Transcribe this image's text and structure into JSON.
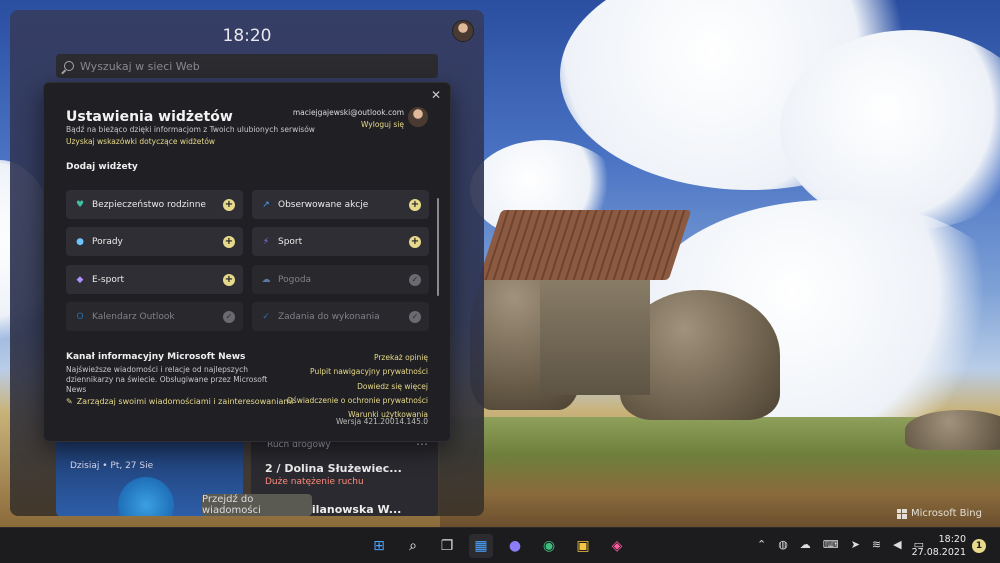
{
  "board": {
    "clock": "18:20",
    "search_placeholder": "Wyszukaj w sieci Web",
    "today": "Dzisiaj • Pt, 27 Sie",
    "traffic_label": "Ruch drogowy",
    "traffic_title": "2 / Dolina Służewiec...",
    "traffic_status": "Duże natężenie ruchu",
    "traffic_road": "Aleja Wilanowska W...",
    "toast": "Przejdź do wiadomości"
  },
  "dialog": {
    "close": "✕",
    "title": "Ustawienia widżetów",
    "subtitle": "Bądź na bieżąco dzięki informacjom z Twoich ulubionych serwisów",
    "tips_link": "Uzyskaj wskazówki dotyczące widżetów",
    "account_email": "maciejgajewski@outlook.com",
    "logout": "Wyloguj się",
    "add_widgets": "Dodaj widżety",
    "widgets": [
      {
        "label": "Bezpieczeństwo rodzinne",
        "icon": "heart-icon",
        "glyph": "♥",
        "color": "#3fbf9f",
        "state": "add"
      },
      {
        "label": "Obserwowane akcje",
        "icon": "stocks-icon",
        "glyph": "↗",
        "color": "#4aa3ff",
        "state": "add"
      },
      {
        "label": "Porady",
        "icon": "lightbulb-icon",
        "glyph": "●",
        "color": "#6fc3ff",
        "state": "add"
      },
      {
        "label": "Sport",
        "icon": "runner-icon",
        "glyph": "⚡",
        "color": "#a070ff",
        "state": "add"
      },
      {
        "label": "E-sport",
        "icon": "gamepad-icon",
        "glyph": "◆",
        "color": "#b090ff",
        "state": "add"
      },
      {
        "label": "Pogoda",
        "icon": "cloud-icon",
        "glyph": "☁",
        "color": "#5a7aa0",
        "state": "added"
      },
      {
        "label": "Kalendarz Outlook",
        "icon": "outlook-icon",
        "glyph": "O",
        "color": "#2a6db0",
        "state": "added"
      },
      {
        "label": "Zadania do wykonania",
        "icon": "todo-icon",
        "glyph": "✓",
        "color": "#3a6ab0",
        "state": "added"
      }
    ],
    "news_heading": "Kanał informacyjny Microsoft News",
    "news_desc": "Najświeższe wiadomości i relacje od najlepszych dziennikarzy na świecie. Obsługiwane przez Microsoft News",
    "manage": "Zarządzaj swoimi wiadomościami i zainteresowaniami",
    "links": [
      "Przekaż opinię",
      "Pulpit nawigacyjny prywatności",
      "Dowiedz się więcej",
      "Oświadczenie o ochronie prywatności",
      "Warunki użytkowania"
    ],
    "version": "Wersja 421.20014.145.0"
  },
  "taskbar": {
    "apps": [
      {
        "name": "start-icon",
        "glyph": "⊞",
        "color": "#4aa3ff",
        "bg": "transparent"
      },
      {
        "name": "search-icon",
        "glyph": "⌕",
        "color": "#ffffff",
        "bg": "transparent"
      },
      {
        "name": "task-view-icon",
        "glyph": "❐",
        "color": "#dddddd",
        "bg": "transparent"
      },
      {
        "name": "widgets-icon",
        "glyph": "▦",
        "color": "#4aa3ff",
        "bg": "#2c2c30"
      },
      {
        "name": "teams-chat-icon",
        "glyph": "●",
        "color": "#8b7cf8",
        "bg": "transparent"
      },
      {
        "name": "edge-canary-icon",
        "glyph": "◉",
        "color": "#3fbf7f",
        "bg": "transparent"
      },
      {
        "name": "store-icon",
        "glyph": "▣",
        "color": "#f4c542",
        "bg": "transparent"
      },
      {
        "name": "photos-icon",
        "glyph": "◈",
        "color": "#ff5a9e",
        "bg": "transparent"
      }
    ],
    "tray": [
      {
        "name": "chevron-up-icon",
        "glyph": "⌃"
      },
      {
        "name": "meet-now-icon",
        "glyph": "◍"
      },
      {
        "name": "onedrive-icon",
        "glyph": "☁"
      },
      {
        "name": "keyboard-icon",
        "glyph": "⌨"
      },
      {
        "name": "location-icon",
        "glyph": "➤"
      },
      {
        "name": "wifi-icon",
        "glyph": "≋"
      },
      {
        "name": "volume-icon",
        "glyph": "◀"
      },
      {
        "name": "battery-icon",
        "glyph": "▭"
      }
    ],
    "time": "18:20",
    "date": "27.08.2021",
    "notification_count": "1"
  },
  "wallpaper": {
    "watermark": "Microsoft Bing"
  }
}
